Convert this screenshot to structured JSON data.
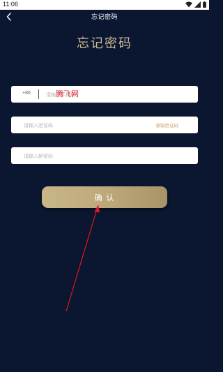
{
  "status_bar": {
    "time": "11:06",
    "icons": [
      "wifi-icon",
      "signal-icon",
      "battery-icon"
    ]
  },
  "header": {
    "back_icon": "chevron-left-icon",
    "title": "忘记密码"
  },
  "page": {
    "title": "忘记密码"
  },
  "form": {
    "phone": {
      "country_code": "+86",
      "placeholder": "请输入手机号",
      "value": ""
    },
    "verification_code": {
      "placeholder": "请输入验证码",
      "value": "",
      "get_code_label": "获取验证码"
    },
    "new_password": {
      "placeholder": "请输入新密码",
      "value": ""
    },
    "confirm_label": "确 认"
  },
  "watermark": {
    "text": "腾飞网"
  },
  "colors": {
    "background": "#0b1730",
    "title_gold": "#cbb895",
    "button_gold": "#c8b688",
    "link_gold": "#c9a36c",
    "annotation_red": "#e0151c"
  }
}
